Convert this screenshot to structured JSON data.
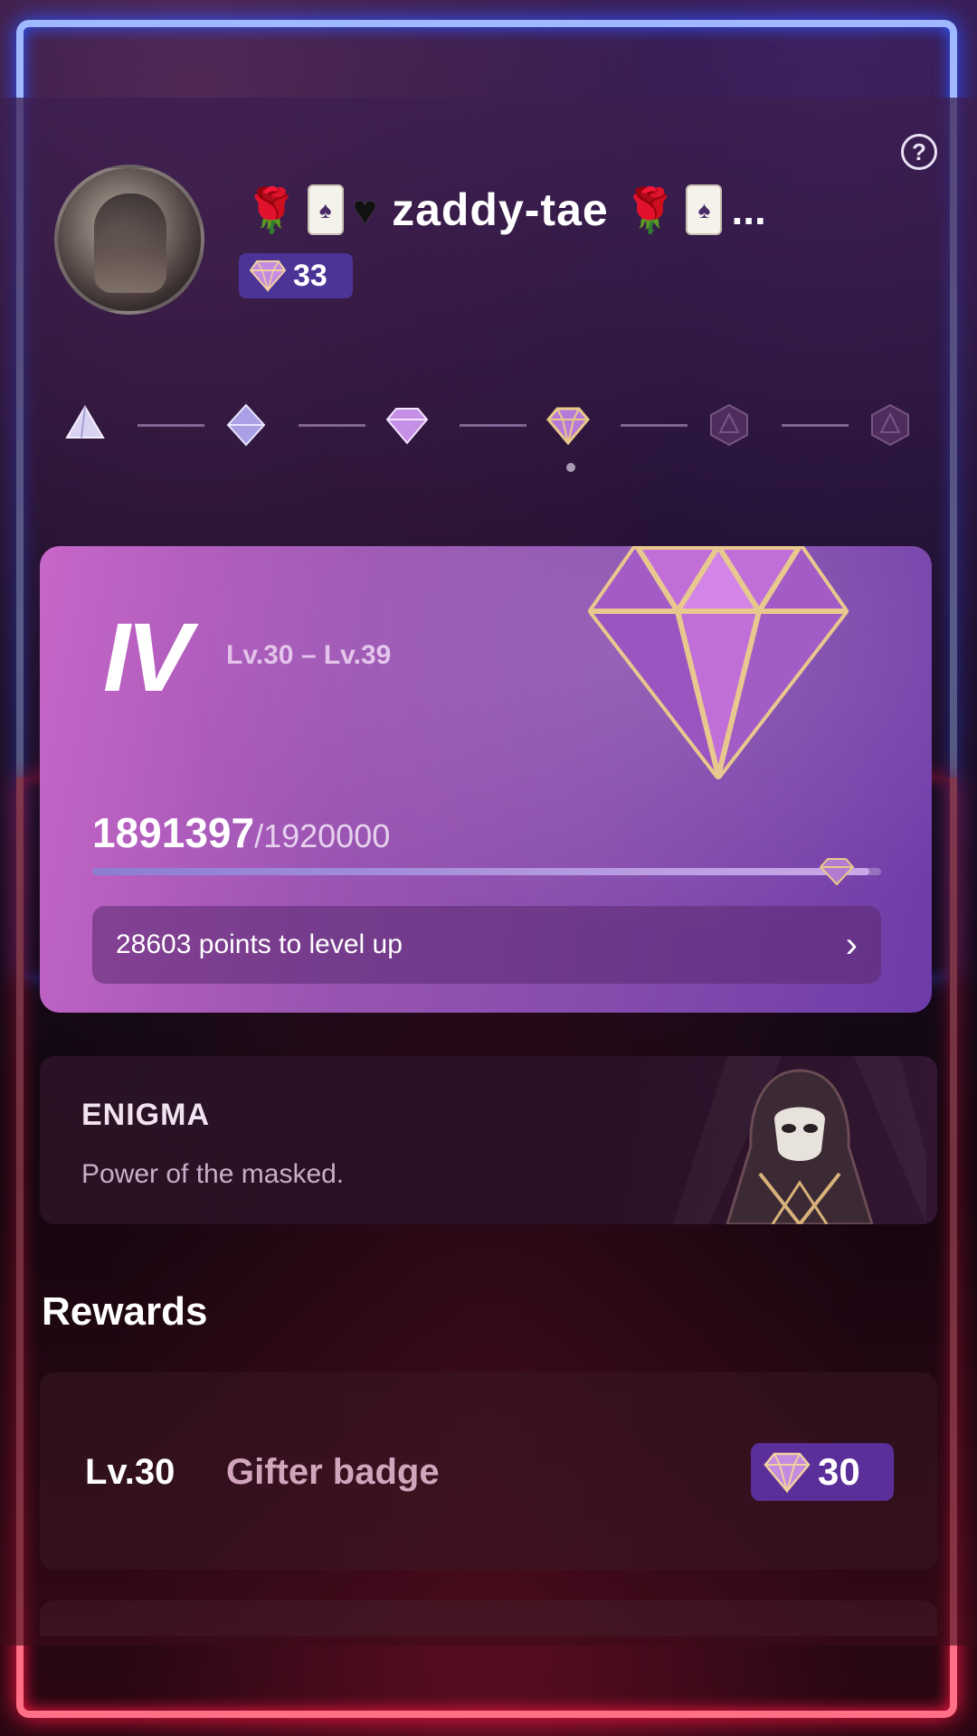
{
  "profile": {
    "username": "zaddy-tae",
    "ellipsis": "...",
    "gem_count": "33",
    "help_icon": "question-circle-icon"
  },
  "tiers": {
    "icons": [
      "tier-1-gem-icon",
      "tier-2-gem-icon",
      "tier-3-gem-icon",
      "tier-4-gem-icon",
      "tier-5-locked-icon",
      "tier-6-locked-icon"
    ],
    "current_index": 3
  },
  "level_card": {
    "tier_roman": "IV",
    "level_range": "Lv.30 – Lv.39",
    "points_current": "1891397",
    "points_target": "/1920000",
    "progress_fraction": 0.985,
    "levelup_text": "28603 points to level up"
  },
  "enigma": {
    "title": "ENIGMA",
    "subtitle": "Power of the masked."
  },
  "rewards": {
    "title": "Rewards",
    "items": [
      {
        "level": "Lv.30",
        "name": "Gifter badge",
        "badge_value": "30"
      }
    ]
  },
  "colors": {
    "card_accent": "#9b55b3",
    "badge_bg": "#5b2f9a",
    "neon_top": "#2d53ff",
    "neon_bottom": "#ff1744"
  }
}
